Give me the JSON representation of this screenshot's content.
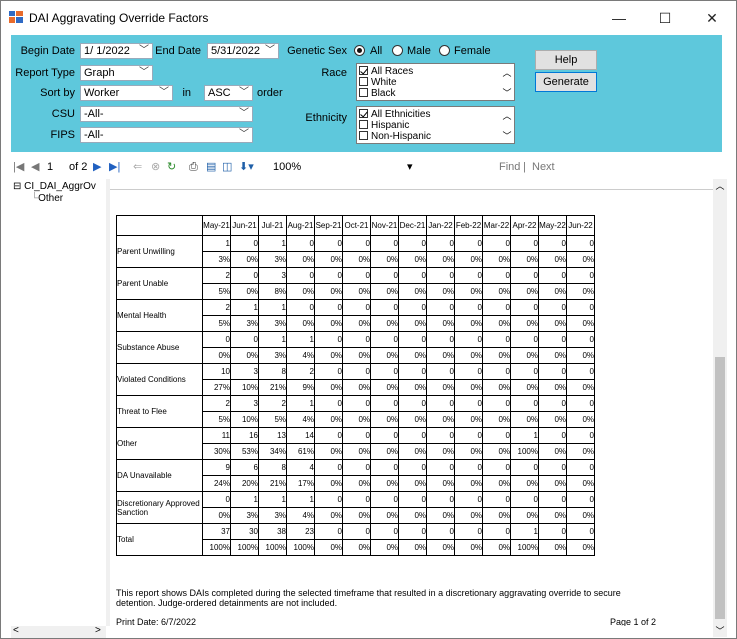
{
  "window": {
    "title": "DAI Aggravating Override Factors",
    "minimize": "—",
    "maximize": "☐",
    "close": "✕"
  },
  "form": {
    "begin_date_label": "Begin Date",
    "begin_date": "1/ 1/2022",
    "end_date_label": "End Date",
    "end_date": "5/31/2022",
    "genetic_sex_label": "Genetic Sex",
    "sex_options": [
      "All",
      "Male",
      "Female"
    ],
    "sex_selected": "All",
    "report_type_label": "Report Type",
    "report_type": "Graph",
    "sort_by_label": "Sort by",
    "sort_by": "Worker",
    "in_label": "in",
    "order_value": "ASC",
    "order_label": "order",
    "race_label": "Race",
    "race_items": [
      "All Races",
      "White",
      "Black"
    ],
    "csu_label": "CSU",
    "csu_value": "-All-",
    "fips_label": "FIPS",
    "fips_value": "-All-",
    "ethnicity_label": "Ethnicity",
    "ethnicity_items": [
      "All Ethnicities",
      "Hispanic",
      "Non-Hispanic"
    ],
    "help_button": "Help",
    "generate_button": "Generate"
  },
  "toolbar": {
    "page_current": "1",
    "page_of": "of 2",
    "zoom": "100%",
    "find": "Find",
    "separator": "|",
    "next": "Next"
  },
  "tree": {
    "root": "CI_DAI_AggrOv",
    "child": "Other"
  },
  "report": {
    "months": [
      "May-21",
      "Jun-21",
      "Jul-21",
      "Aug-21",
      "Sep-21",
      "Oct-21",
      "Nov-21",
      "Dec-21",
      "Jan-22",
      "Feb-22",
      "Mar-22",
      "Apr-22",
      "May-22",
      "Jun-22"
    ],
    "rows": [
      {
        "label": "Parent Unwilling",
        "counts": [
          "1",
          "0",
          "1",
          "0",
          "0",
          "0",
          "0",
          "0",
          "0",
          "0",
          "0",
          "0",
          "0",
          "0"
        ],
        "pcts": [
          "3%",
          "0%",
          "3%",
          "0%",
          "0%",
          "0%",
          "0%",
          "0%",
          "0%",
          "0%",
          "0%",
          "0%",
          "0%",
          "0%"
        ]
      },
      {
        "label": "Parent Unable",
        "counts": [
          "2",
          "0",
          "3",
          "0",
          "0",
          "0",
          "0",
          "0",
          "0",
          "0",
          "0",
          "0",
          "0",
          "0"
        ],
        "pcts": [
          "5%",
          "0%",
          "8%",
          "0%",
          "0%",
          "0%",
          "0%",
          "0%",
          "0%",
          "0%",
          "0%",
          "0%",
          "0%",
          "0%"
        ]
      },
      {
        "label": "Mental Health",
        "counts": [
          "2",
          "1",
          "1",
          "0",
          "0",
          "0",
          "0",
          "0",
          "0",
          "0",
          "0",
          "0",
          "0",
          "0"
        ],
        "pcts": [
          "5%",
          "3%",
          "3%",
          "0%",
          "0%",
          "0%",
          "0%",
          "0%",
          "0%",
          "0%",
          "0%",
          "0%",
          "0%",
          "0%"
        ]
      },
      {
        "label": "Substance Abuse",
        "counts": [
          "0",
          "0",
          "1",
          "1",
          "0",
          "0",
          "0",
          "0",
          "0",
          "0",
          "0",
          "0",
          "0",
          "0"
        ],
        "pcts": [
          "0%",
          "0%",
          "3%",
          "4%",
          "0%",
          "0%",
          "0%",
          "0%",
          "0%",
          "0%",
          "0%",
          "0%",
          "0%",
          "0%"
        ]
      },
      {
        "label": "Violated Conditions",
        "counts": [
          "10",
          "3",
          "8",
          "2",
          "0",
          "0",
          "0",
          "0",
          "0",
          "0",
          "0",
          "0",
          "0",
          "0"
        ],
        "pcts": [
          "27%",
          "10%",
          "21%",
          "9%",
          "0%",
          "0%",
          "0%",
          "0%",
          "0%",
          "0%",
          "0%",
          "0%",
          "0%",
          "0%"
        ]
      },
      {
        "label": "Threat to Flee",
        "counts": [
          "2",
          "3",
          "2",
          "1",
          "0",
          "0",
          "0",
          "0",
          "0",
          "0",
          "0",
          "0",
          "0",
          "0"
        ],
        "pcts": [
          "5%",
          "10%",
          "5%",
          "4%",
          "0%",
          "0%",
          "0%",
          "0%",
          "0%",
          "0%",
          "0%",
          "0%",
          "0%",
          "0%"
        ]
      },
      {
        "label": "Other",
        "counts": [
          "11",
          "16",
          "13",
          "14",
          "0",
          "0",
          "0",
          "0",
          "0",
          "0",
          "0",
          "1",
          "0",
          "0"
        ],
        "pcts": [
          "30%",
          "53%",
          "34%",
          "61%",
          "0%",
          "0%",
          "0%",
          "0%",
          "0%",
          "0%",
          "0%",
          "100%",
          "0%",
          "0%"
        ]
      },
      {
        "label": "DA Unavailable",
        "counts": [
          "9",
          "6",
          "8",
          "4",
          "0",
          "0",
          "0",
          "0",
          "0",
          "0",
          "0",
          "0",
          "0",
          "0"
        ],
        "pcts": [
          "24%",
          "20%",
          "21%",
          "17%",
          "0%",
          "0%",
          "0%",
          "0%",
          "0%",
          "0%",
          "0%",
          "0%",
          "0%",
          "0%"
        ]
      },
      {
        "label": "Discretionary Approved Sanction",
        "counts": [
          "0",
          "1",
          "1",
          "1",
          "0",
          "0",
          "0",
          "0",
          "0",
          "0",
          "0",
          "0",
          "0",
          "0"
        ],
        "pcts": [
          "0%",
          "3%",
          "3%",
          "4%",
          "0%",
          "0%",
          "0%",
          "0%",
          "0%",
          "0%",
          "0%",
          "0%",
          "0%",
          "0%"
        ]
      },
      {
        "label": "Total",
        "counts": [
          "37",
          "30",
          "38",
          "23",
          "0",
          "0",
          "0",
          "0",
          "0",
          "0",
          "0",
          "1",
          "0",
          "0"
        ],
        "pcts": [
          "100%",
          "100%",
          "100%",
          "100%",
          "0%",
          "0%",
          "0%",
          "0%",
          "0%",
          "0%",
          "0%",
          "100%",
          "0%",
          "0%"
        ]
      }
    ],
    "footnote": "This report shows DAIs completed during the selected timeframe that resulted in a discretionary aggravating override to secure detention. Judge-ordered detainments are not included.",
    "print_date": "Print Date: 6/7/2022",
    "page_label": "Page 1 of 2"
  }
}
